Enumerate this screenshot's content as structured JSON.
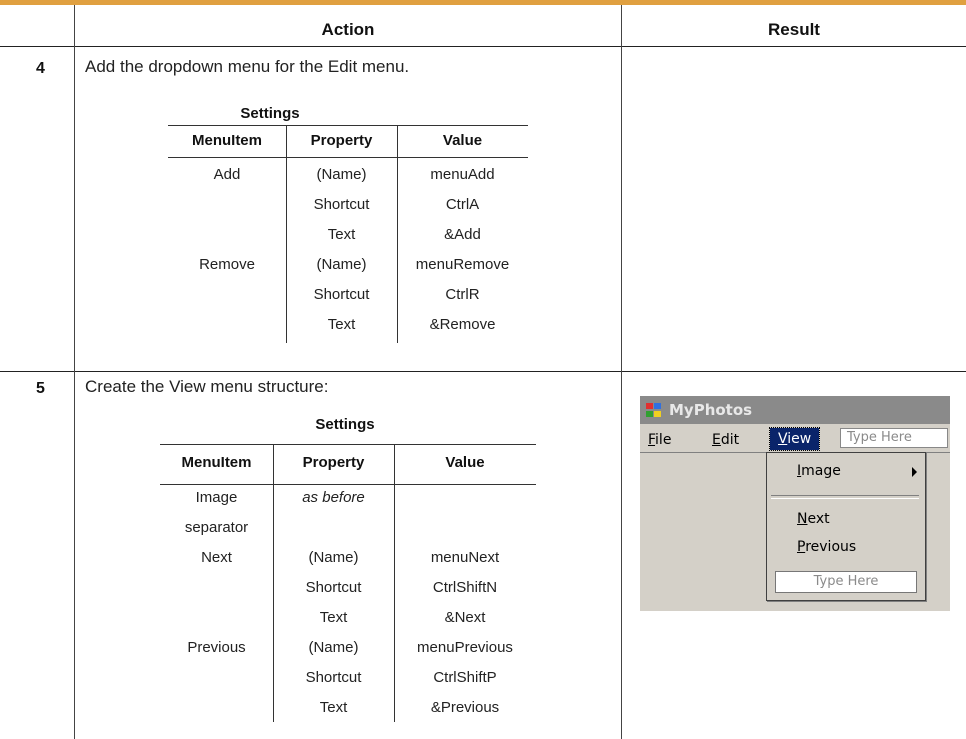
{
  "header": {
    "action": "Action",
    "result": "Result"
  },
  "step4": {
    "number": "4",
    "text": "Add the dropdown menu for the Edit menu.",
    "settings_title": "Settings",
    "columns": [
      "MenuItem",
      "Property",
      "Value"
    ],
    "rows": [
      [
        "Add",
        "(Name)",
        "menuAdd"
      ],
      [
        "",
        "Shortcut",
        "CtrlA"
      ],
      [
        "",
        "Text",
        "&Add"
      ],
      [
        "Remove",
        "(Name)",
        "menuRemove"
      ],
      [
        "",
        "Shortcut",
        "CtrlR"
      ],
      [
        "",
        "Text",
        "&Remove"
      ]
    ]
  },
  "step5": {
    "number": "5",
    "text": "Create the View menu structure:",
    "settings_title": "Settings",
    "columns": [
      "MenuItem",
      "Property",
      "Value"
    ],
    "rows": [
      [
        "Image",
        "as before",
        ""
      ],
      [
        "separator",
        "",
        ""
      ],
      [
        "Next",
        "(Name)",
        "menuNext"
      ],
      [
        "",
        "Shortcut",
        "CtrlShiftN"
      ],
      [
        "",
        "Text",
        "&Next"
      ],
      [
        "Previous",
        "(Name)",
        "menuPrevious"
      ],
      [
        "",
        "Shortcut",
        "CtrlShiftP"
      ],
      [
        "",
        "Text",
        "&Previous"
      ]
    ]
  },
  "screenshot": {
    "window_title": "MyPhotos",
    "menubar": {
      "file_access": "F",
      "file_rest": "ile",
      "edit_access": "E",
      "edit_rest": "dit",
      "view_access": "V",
      "view_rest": "iew",
      "type_here": "Type Here"
    },
    "dropdown": {
      "image_access": "I",
      "image_rest": "mage",
      "next_access": "N",
      "next_rest": "ext",
      "previous_access": "P",
      "previous_rest": "revious",
      "type_here": "Type Here"
    }
  }
}
